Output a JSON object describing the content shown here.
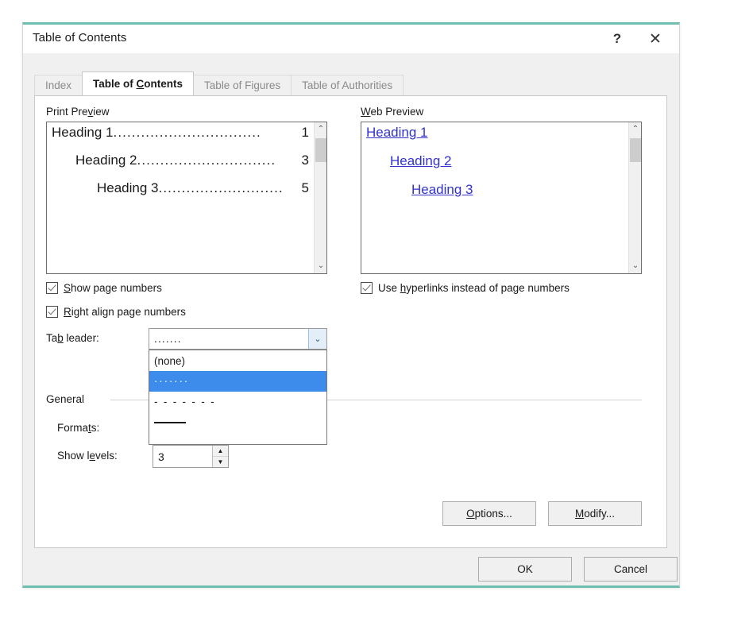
{
  "dialog": {
    "title": "Table of Contents",
    "help_icon": "question-mark-icon",
    "close_icon": "close-x-icon",
    "help_glyph": "?",
    "close_glyph": "✕",
    "accent_color": "#6fbfb0"
  },
  "tabs": [
    {
      "label": "Index",
      "active": false
    },
    {
      "label": "Table of ",
      "accel": "C",
      "label_tail": "ontents",
      "active": true
    },
    {
      "label": "Table of Figures",
      "active": false
    },
    {
      "label": "Table of Authorities",
      "active": false
    }
  ],
  "print_preview": {
    "label_head": "Print Pre",
    "label_accel": "v",
    "label_tail": "iew",
    "entries": [
      {
        "text": "Heading 1",
        "leader": "................................",
        "page": "1",
        "indent": 0
      },
      {
        "text": "Heading 2 ",
        "leader": "..............................",
        "page": "3",
        "indent": 30
      },
      {
        "text": "Heading 3",
        "leader": "...........................",
        "page": "5",
        "indent": 57
      }
    ],
    "scroll_up_glyph": "⌃",
    "scroll_down_glyph": "⌄"
  },
  "web_preview": {
    "label_accel": "W",
    "label_tail": "eb Preview",
    "entries": [
      {
        "text": "Heading 1",
        "indent": 0
      },
      {
        "text": "Heading 2",
        "indent": 30
      },
      {
        "text": "Heading 3",
        "indent": 57
      }
    ],
    "link_color": "#3232cd",
    "scroll_up_glyph": "⌃",
    "scroll_down_glyph": "⌄"
  },
  "options": {
    "show_page_numbers": {
      "checked": true,
      "head": "",
      "accel": "S",
      "tail": "how page numbers"
    },
    "right_align": {
      "checked": true,
      "head": "",
      "accel": "R",
      "tail": "ight align page numbers"
    },
    "use_hyperlinks": {
      "checked": true,
      "head": "Use ",
      "accel": "h",
      "tail": "yperlinks instead of page numbers"
    }
  },
  "tab_leader": {
    "label_head": "Ta",
    "label_accel": "b",
    "label_tail": " leader:",
    "value": ".......",
    "arrow_glyph": "⌄",
    "expanded": true,
    "items": [
      {
        "kind": "text",
        "label": "(none)",
        "selected": false
      },
      {
        "kind": "dotted",
        "label": "·······",
        "selected": true
      },
      {
        "kind": "dashed",
        "label": "- - - - - - -",
        "selected": false
      },
      {
        "kind": "solid",
        "label": "",
        "selected": false
      }
    ],
    "highlight_color": "#3d8bea"
  },
  "general": {
    "group_label": "General",
    "formats": {
      "head": "Forma",
      "accel": "t",
      "tail": "s:"
    },
    "show_levels": {
      "head": "Show l",
      "accel": "e",
      "tail": "vels:",
      "value": "3",
      "up_glyph": "▲",
      "down_glyph": "▼"
    }
  },
  "buttons": {
    "options": {
      "head": "",
      "accel": "O",
      "tail": "ptions..."
    },
    "modify": {
      "head": "",
      "accel": "M",
      "tail": "odify..."
    },
    "ok": {
      "label": "OK"
    },
    "cancel": {
      "label": "Cancel"
    }
  }
}
